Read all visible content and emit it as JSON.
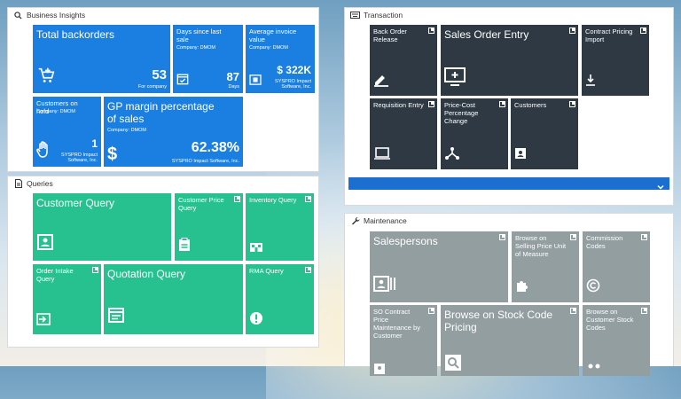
{
  "business_insights": {
    "title": "Business Insights",
    "tiles": {
      "total_backorders": {
        "title": "Total backorders",
        "value": "53",
        "caption": "For company"
      },
      "days_since": {
        "title": "Days since last sale",
        "company": "Company: DMOM",
        "value": "87",
        "caption": "Days"
      },
      "avg_invoice": {
        "title": "Average invoice value",
        "company": "Company: DMOM",
        "value": "$ 322K",
        "caption": "SYSPRO Impact Software, Inc."
      },
      "customers_on_hold": {
        "title": "Customers on hold",
        "company": "Company: DMOM",
        "value": "1",
        "caption": "SYSPRO Impact Software, Inc."
      },
      "gp_margin": {
        "title": "GP margin percentage of sales",
        "company": "Company: DMOM",
        "value": "62.38%",
        "caption": "SYSPRO Impact Software, Inc."
      }
    }
  },
  "queries": {
    "title": "Queries",
    "tiles": {
      "customer_query": "Customer Query",
      "customer_price_query": "Customer Price Query",
      "inventory_query": "Inventory Query",
      "order_intake_query": "Order Intake Query",
      "quotation_query": "Quotation Query",
      "rma_query": "RMA Query"
    }
  },
  "transaction": {
    "title": "Transaction",
    "tiles": {
      "back_order_release": "Back Order Release",
      "sales_order_entry": "Sales Order Entry",
      "contract_pricing_import": "Contract Pricing Import",
      "requisition_entry": "Requisition Entry",
      "price_cost_change": "Price-Cost Percentage Change",
      "customers": "Customers"
    }
  },
  "maintenance": {
    "title": "Maintenance",
    "tiles": {
      "salespersons": "Salespersons",
      "browse_selling_price": "Browse on Selling Price Unit of Measure",
      "commission_codes": "Commission Codes",
      "so_contract_price": "SO Contract Price Maintenance by Customer",
      "browse_stock_code_pricing": "Browse on Stock Code Pricing",
      "browse_customer_stock_codes": "Browse on Customer Stock Codes"
    }
  },
  "colors": {
    "insights_blue": "#1a7fe0",
    "transaction_dark": "#2e3944",
    "queries_green": "#27c08f",
    "maintenance_gray": "#939ea1"
  }
}
